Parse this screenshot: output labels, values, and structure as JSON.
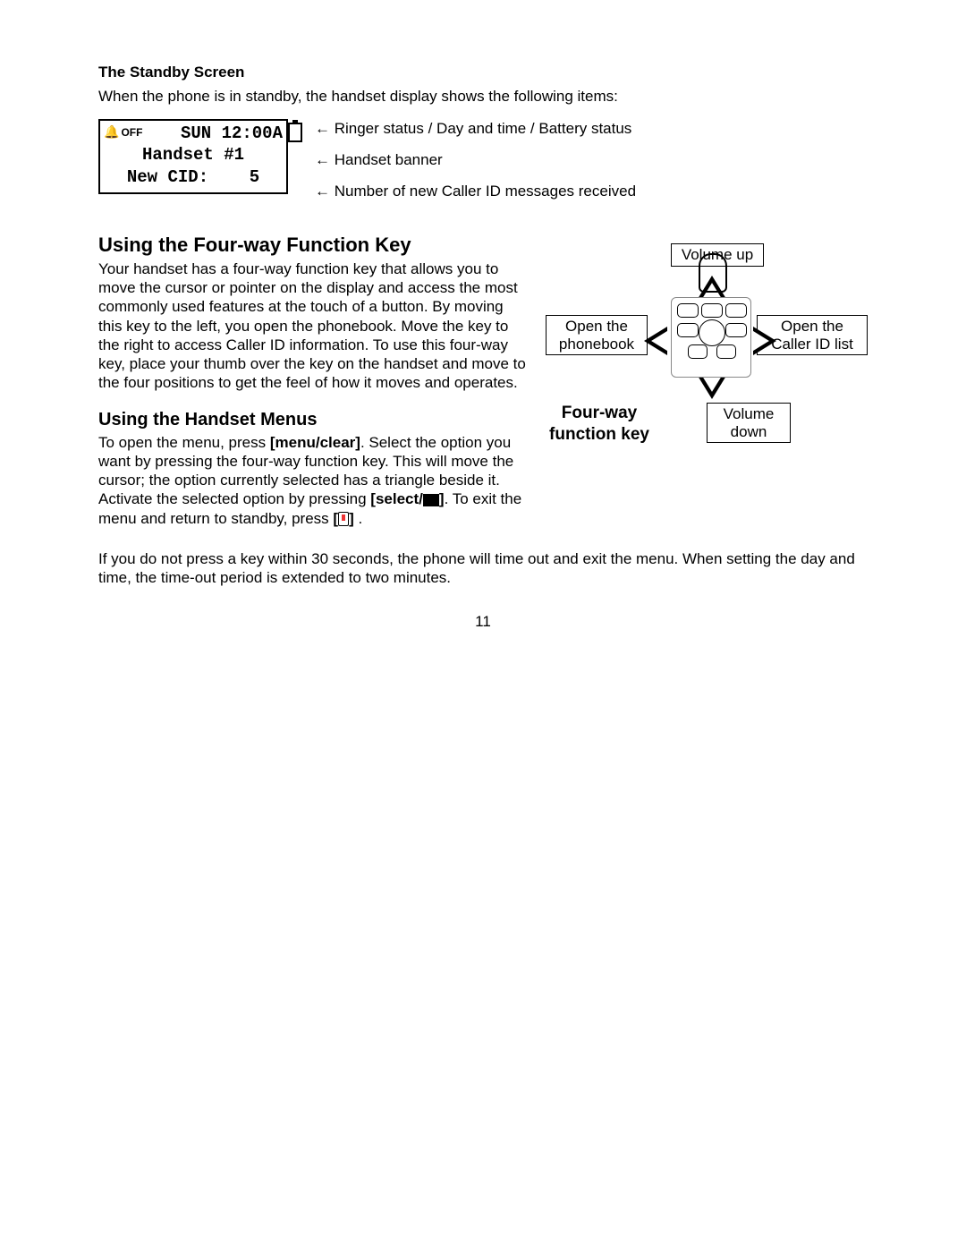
{
  "sections": {
    "standby_title": "The Standby Screen",
    "standby_intro": "When the phone is in standby, the handset display shows the following items:",
    "lcd": {
      "ringer_label": "OFF",
      "day": "SUN",
      "time": "12:00A",
      "banner": "Handset #1",
      "cid_label": "New CID:",
      "cid_count": "5"
    },
    "callouts": {
      "line1": "← Ringer status / Day and time / Battery status",
      "line2": "← Handset banner",
      "line3": "← Number of new Caller ID messages received"
    },
    "fourway_title": "Using the Four-way Function Key",
    "fourway_text": "Your handset has a four-way function key that allows you to move the cursor or pointer on the display and access the most commonly used features at the touch of a button. By moving this key to the left, you open the phonebook. Move the key to the right to access Caller ID information. To use this four-way key, place your thumb over the key on the handset and move to the four positions to get the feel of how it moves and operates.",
    "menus_title": "Using the Handset Menus",
    "menus_text_1": "To open the menu, press ",
    "menus_key_1": "[menu/clear]",
    "menus_text_2": ". Select the option you want by pressing the four-way function key. This will move the cursor; the option currently selected has a triangle beside it. Activate the selected option by pressing ",
    "menus_key_2": "[select/",
    "menus_key_2b": "]",
    "menus_text_3": ". To exit the menu and return to standby, press ",
    "menus_key_3a": "[",
    "menus_key_3b": "]",
    "menus_text_4": " .",
    "timeout_text": "If you do not press a key within 30 seconds, the phone will time out and exit the menu. When setting the day and time, the time-out period is extended to two minutes.",
    "page_number": "11"
  },
  "figure": {
    "up": "Volume up",
    "down": "Volume down",
    "left_l1": "Open the",
    "left_l2": "phonebook",
    "right_l1": "Open the",
    "right_l2": "Caller ID list",
    "label_l1": "Four-way",
    "label_l2": "function key"
  }
}
